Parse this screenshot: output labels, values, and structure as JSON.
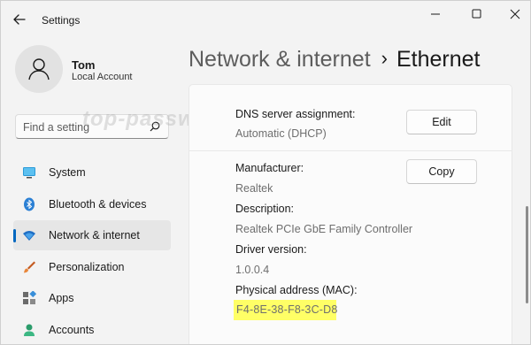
{
  "window": {
    "title": "Settings",
    "controls": [
      "minimize",
      "maximize",
      "close"
    ]
  },
  "profile": {
    "name": "Tom",
    "account_type": "Local Account"
  },
  "search": {
    "placeholder": "Find a setting"
  },
  "sidebar": {
    "items": [
      {
        "label": "System",
        "icon": "monitor-icon",
        "selected": false
      },
      {
        "label": "Bluetooth & devices",
        "icon": "bluetooth-icon",
        "selected": false
      },
      {
        "label": "Network & internet",
        "icon": "wifi-icon",
        "selected": true
      },
      {
        "label": "Personalization",
        "icon": "brush-icon",
        "selected": false
      },
      {
        "label": "Apps",
        "icon": "apps-icon",
        "selected": false
      },
      {
        "label": "Accounts",
        "icon": "person-icon",
        "selected": false
      }
    ]
  },
  "breadcrumb": {
    "parent": "Network & internet",
    "separator": "›",
    "current": "Ethernet"
  },
  "details": {
    "dns_label": "DNS server assignment:",
    "dns_value": "Automatic (DHCP)",
    "edit_label": "Edit",
    "manufacturer_label": "Manufacturer:",
    "manufacturer_value": "Realtek",
    "copy_label": "Copy",
    "description_label": "Description:",
    "description_value": "Realtek PCIe GbE Family Controller",
    "driver_label": "Driver version:",
    "driver_value": "1.0.0.4",
    "mac_label": "Physical address (MAC):",
    "mac_value": "F4-8E-38-F8-3C-D8"
  },
  "watermark": "top-password.com",
  "colors": {
    "accent": "#0067c0",
    "highlight": "#ffff66",
    "background": "#f3f3f3",
    "card": "#fbfbfb"
  }
}
